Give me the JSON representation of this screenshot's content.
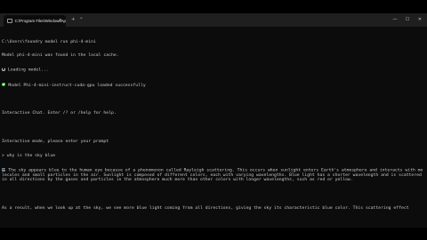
{
  "window": {
    "tab_title": "C:\\Program Files\\WindowsAp",
    "tab_close": "×",
    "new_tab": "+",
    "dropdown": "⌄",
    "minimize": "—",
    "maximize": "☐",
    "close": "✕"
  },
  "terminal": {
    "lines": [
      "C:\\Users\\foundry model run phi-4-mini",
      "Model phi-4-mini was found in the local cache.",
      " Loading model...",
      " Model Phi-4-mini-instruct-cuda-gpu loaded successfully",
      "",
      "Interactive Chat. Enter /? or /help for help.",
      "",
      "Interactive mode, please enter your prompt",
      "> why is the sky blue",
      " The sky appears blue to the human eye because of a phenomenon called Rayleigh scattering. This occurs when sunlight enters Earth's atmosphere and interacts with molecules and small particles in the air. Sunlight is composed of different colors, each with varying wavelengths. Blue light has a shorter wavelength and is scattered in all directions by the gases and particles in the atmosphere much more than other colors with longer wavelengths, such as red or yellow.",
      "",
      "As a result, when we look up at the sky, we see more blue light coming from all directions, giving the sky its characteristic blue color. This scattering effect"
    ]
  },
  "icons": {
    "line_2": "spinner-icon",
    "line_3": "check-icon",
    "line_9": "robot-icon"
  },
  "colors": {
    "terminal_bg": "#0c0c0c",
    "terminal_text": "#cccccc",
    "titlebar_bg": "#1f1f1f",
    "success": "#16c60c"
  }
}
